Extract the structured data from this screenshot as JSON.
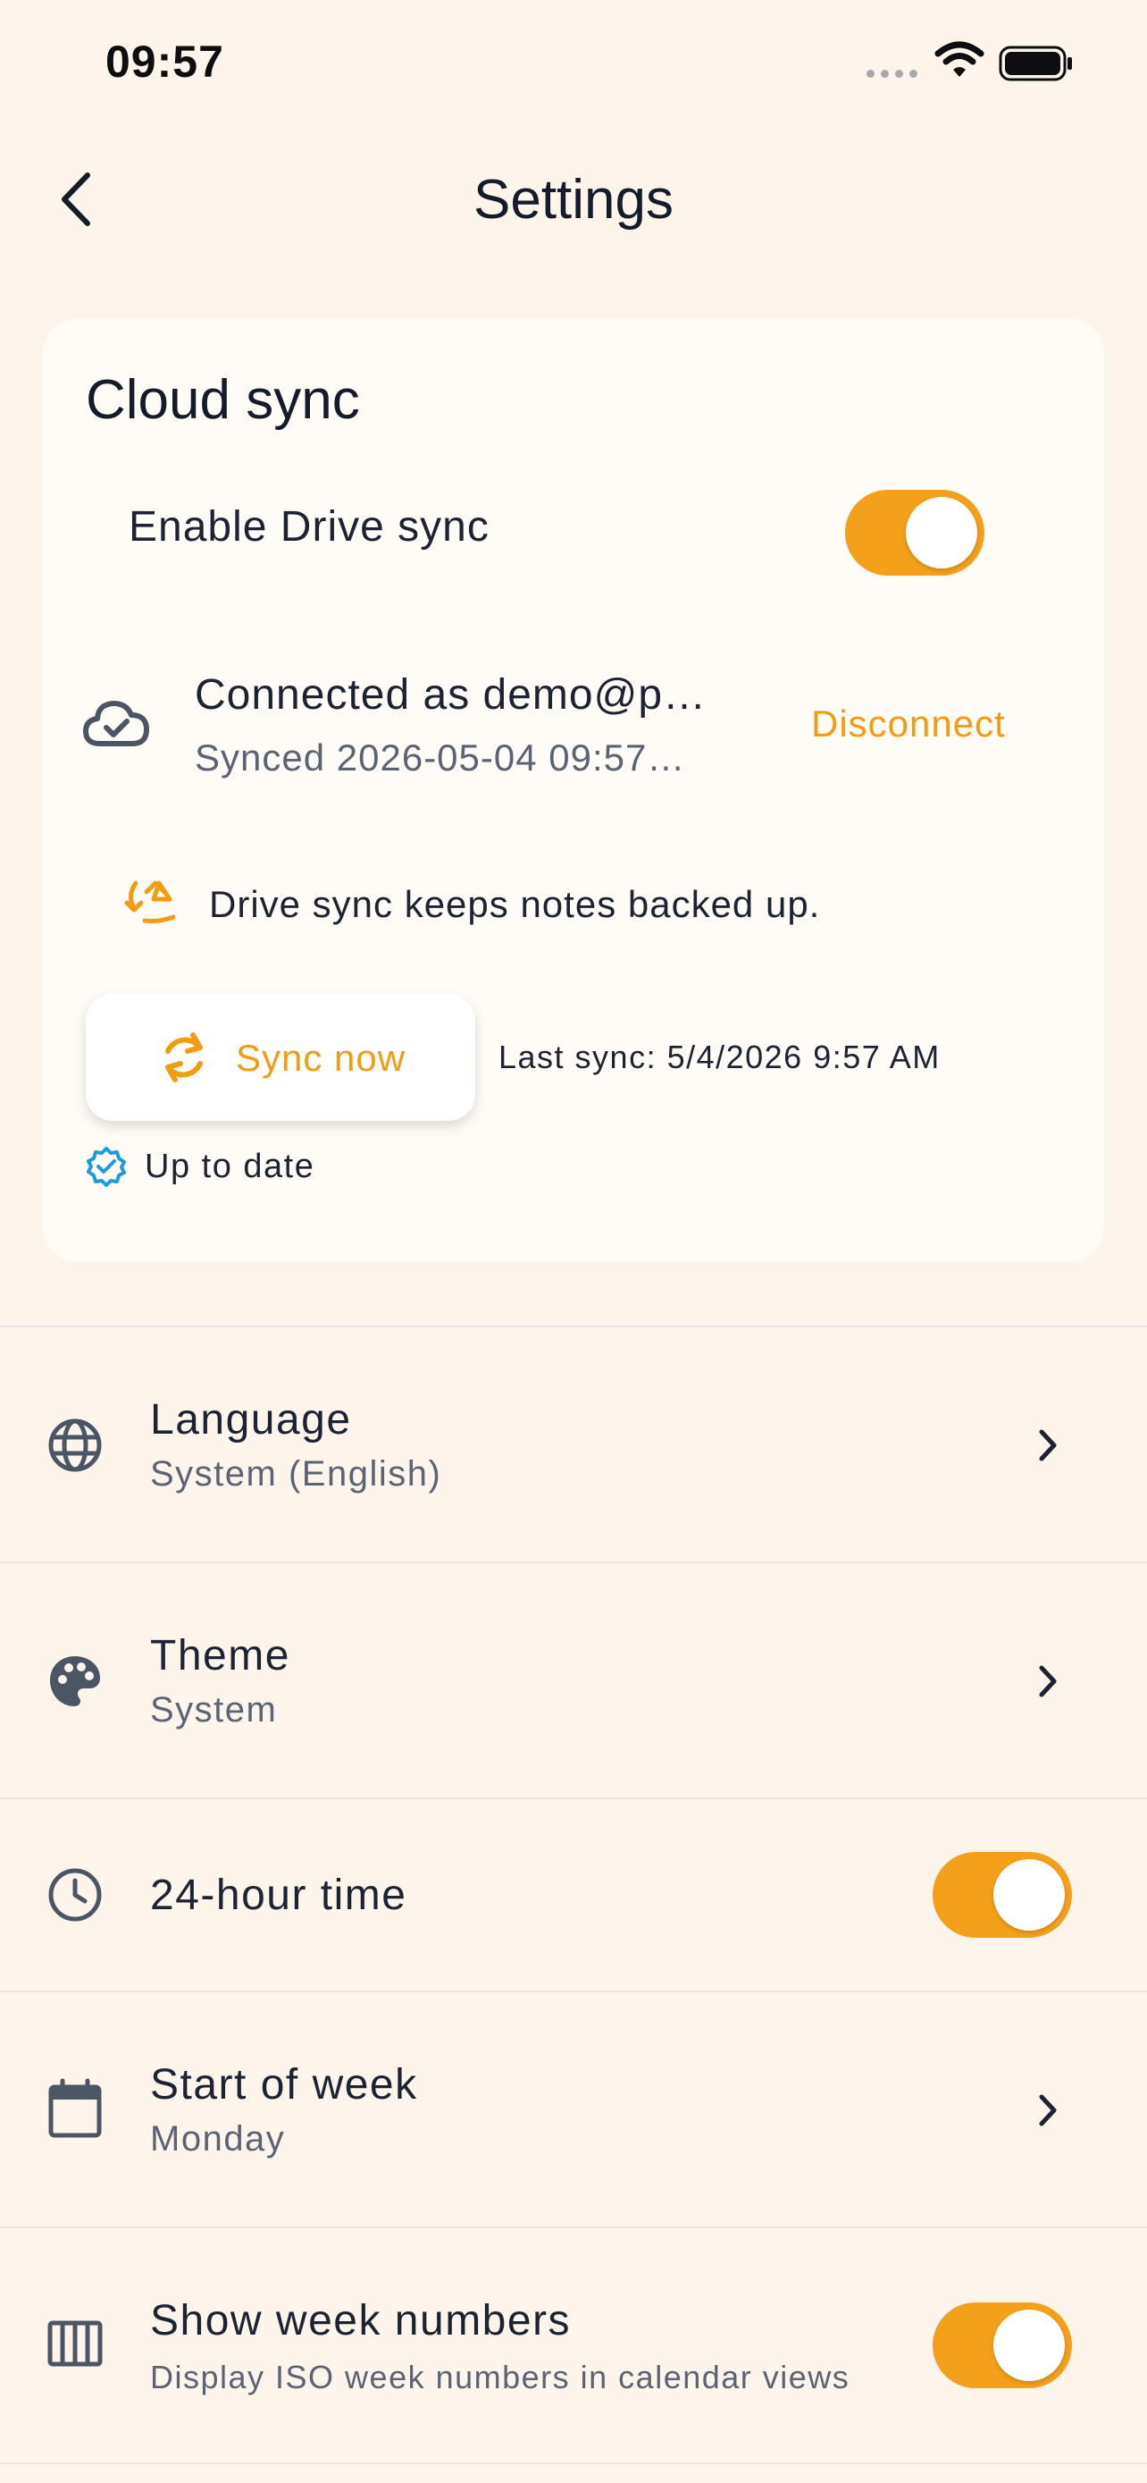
{
  "status_bar": {
    "time": "09:57"
  },
  "nav": {
    "title": "Settings"
  },
  "cloud_sync": {
    "title": "Cloud sync",
    "enable_label": "Enable Drive sync",
    "enabled": true,
    "account_line": "Connected as demo@p…",
    "synced_line": "Synced 2026-05-04 09:57…",
    "disconnect_label": "Disconnect",
    "hint": "Drive sync keeps notes backed up.",
    "sync_now_label": "Sync now",
    "last_sync": "Last sync: 5/4/2026 9:57 AM",
    "status": "Up to date"
  },
  "settings": [
    {
      "icon": "globe-icon",
      "title": "Language",
      "subtitle": "System (English)",
      "control": "chevron"
    },
    {
      "icon": "palette-icon",
      "title": "Theme",
      "subtitle": "System",
      "control": "chevron"
    },
    {
      "icon": "clock-icon",
      "title": "24-hour time",
      "control": "toggle",
      "on": true
    },
    {
      "icon": "calendar-icon",
      "title": "Start of week",
      "subtitle": "Monday",
      "control": "chevron"
    },
    {
      "icon": "week-columns-icon",
      "title": "Show week numbers",
      "subtitle": "Display ISO week numbers in calendar views",
      "control": "toggle",
      "on": true
    }
  ],
  "colors": {
    "accent": "#F4A01A",
    "background": "#FDF5EC",
    "card": "#FFFBF6",
    "verified": "#1E9BE0",
    "text": "#1C2433",
    "muted": "#5A6475"
  }
}
